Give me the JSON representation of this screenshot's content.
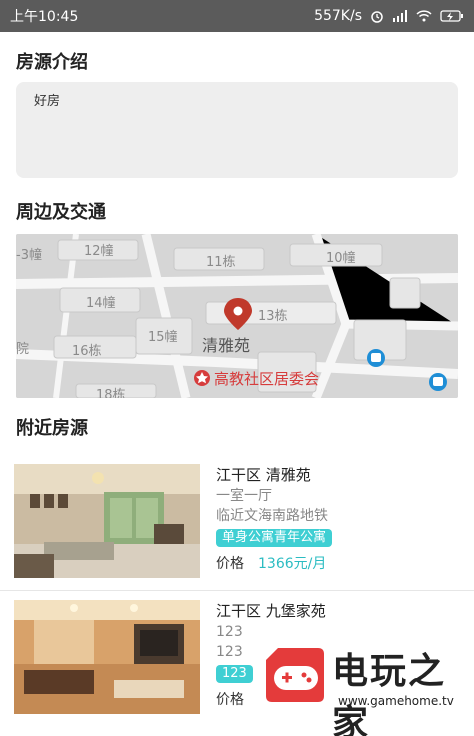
{
  "status_bar": {
    "time": "上午10:45",
    "network_speed": "557K/s",
    "icons": [
      "alarm-icon",
      "signal-icon",
      "wifi-icon",
      "battery-charging-icon"
    ]
  },
  "sections": {
    "intro_title": "房源介绍",
    "intro_text": "好房",
    "nearby_title": "周边及交通",
    "listings_title": "附近房源"
  },
  "map": {
    "center_label": "清雅苑",
    "poi_label": "高教社区居委会",
    "building_labels": [
      "12幢",
      "11栋",
      "10幢",
      "-3幢",
      "14幢",
      "13栋",
      "15幢",
      "16栋",
      "院",
      "18栋"
    ]
  },
  "listings": [
    {
      "title": "江干区 清雅苑",
      "line1": "一室一厅",
      "line2": "临近文海南路地铁",
      "tag": "单身公寓青年公寓",
      "price_label": "价格",
      "price": "1366元/月"
    },
    {
      "title": "江干区 九堡家苑",
      "line1": "123",
      "line2": "123",
      "tag": "123",
      "price_label": "价格",
      "price": ""
    }
  ],
  "watermark": {
    "brand": "电玩之家",
    "url": "www.gamehome.tv"
  },
  "colors": {
    "accent": "#3fcfd3",
    "price": "#2bbcc2",
    "map_pin": "#c0392b"
  }
}
